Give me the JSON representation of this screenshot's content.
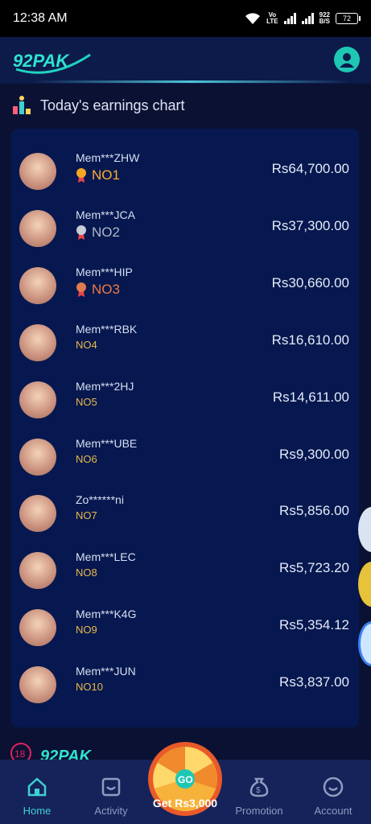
{
  "status": {
    "time": "12:38 AM",
    "speed_value": "922",
    "speed_unit": "B/S",
    "battery": "72",
    "lte_top": "Vo",
    "lte_bottom": "LTE"
  },
  "brand": {
    "logo_text": "92PAK"
  },
  "section": {
    "title": "Today's earnings chart"
  },
  "leaderboard": [
    {
      "name": "Mem***ZHW",
      "rank": "NO1",
      "amount": "Rs64,700.00"
    },
    {
      "name": "Mem***JCA",
      "rank": "NO2",
      "amount": "Rs37,300.00"
    },
    {
      "name": "Mem***HIP",
      "rank": "NO3",
      "amount": "Rs30,660.00"
    },
    {
      "name": "Mem***RBK",
      "rank": "NO4",
      "amount": "Rs16,610.00"
    },
    {
      "name": "Mem***2HJ",
      "rank": "NO5",
      "amount": "Rs14,611.00"
    },
    {
      "name": "Mem***UBE",
      "rank": "NO6",
      "amount": "Rs9,300.00"
    },
    {
      "name": "Zo******ni",
      "rank": "NO7",
      "amount": "Rs5,856.00"
    },
    {
      "name": "Mem***LEC",
      "rank": "NO8",
      "amount": "Rs5,723.20"
    },
    {
      "name": "Mem***K4G",
      "rank": "NO9",
      "amount": "Rs5,354.12"
    },
    {
      "name": "Mem***JUN",
      "rank": "NO10",
      "amount": "Rs3,837.00"
    }
  ],
  "footer": {
    "age_badge": "18",
    "logo_text": "92PAK"
  },
  "nav": {
    "home": "Home",
    "activity": "Activity",
    "spin_label": "Get Rs3,000",
    "spin_center": "GO",
    "promotion": "Promotion",
    "account": "Account"
  },
  "colors": {
    "accent": "#3fd0d2",
    "gold": "#ffae33",
    "silver": "#aeb8c8",
    "bronze": "#f07a44",
    "rank_default": "#e9b84c",
    "board_bg": "#06184f"
  }
}
